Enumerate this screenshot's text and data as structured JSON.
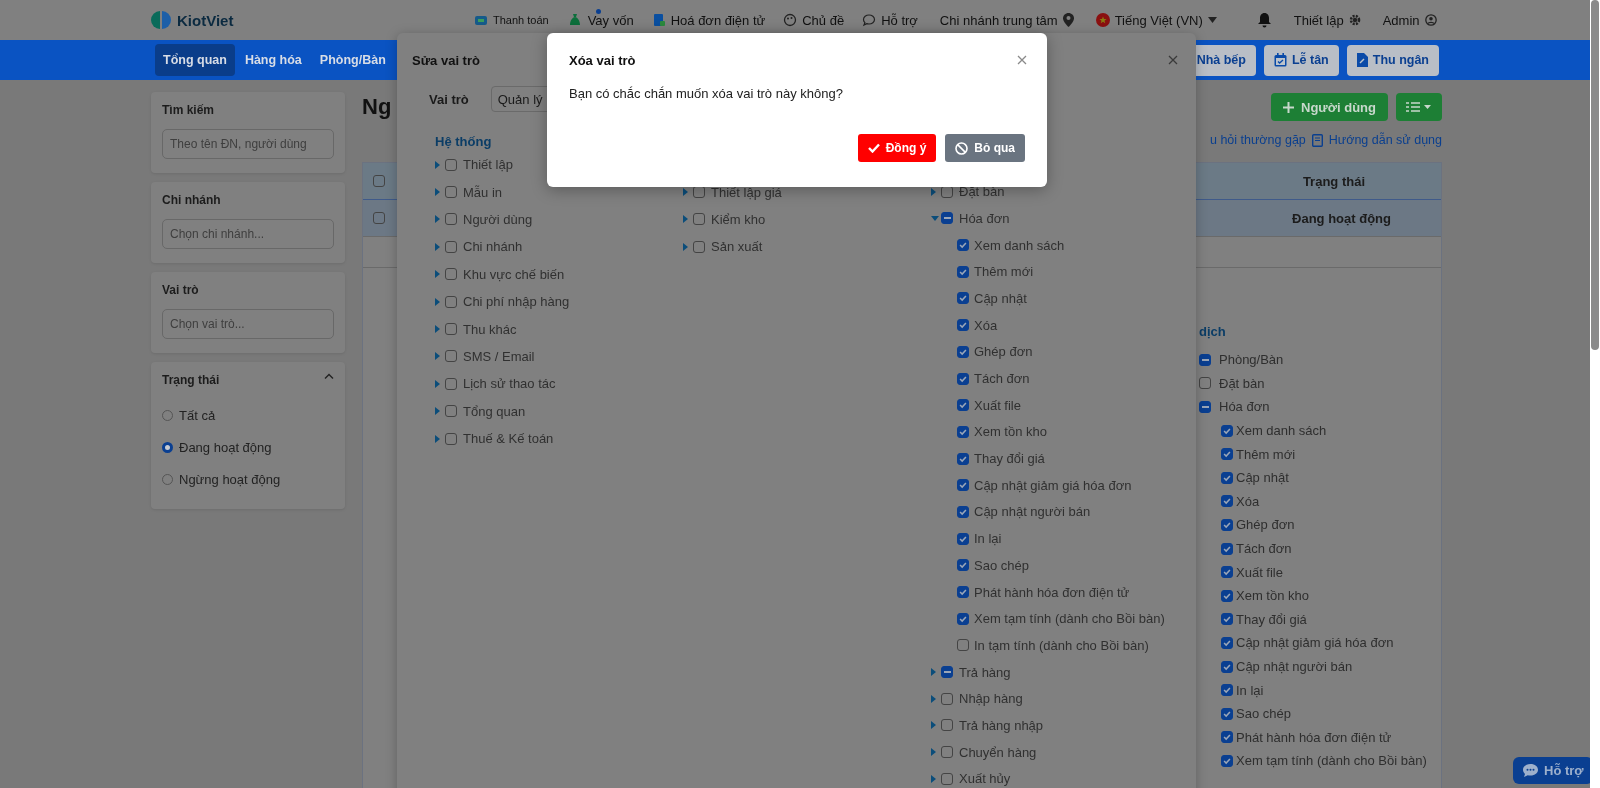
{
  "top_bar": {
    "logo": "KiotViet",
    "links": [
      "Thanh toán",
      "Vay vốn",
      "Hoá đơn điện tử",
      "Chủ đề",
      "Hỗ trợ"
    ],
    "branch": "Chi nhánh trung tâm",
    "language": "Tiếng Việt (VN)",
    "settings": "Thiết lập",
    "user": "Admin"
  },
  "nav": {
    "tabs": [
      {
        "label": "Tổng quan",
        "selected": true
      },
      {
        "label": "Hàng hóa",
        "selected": false
      },
      {
        "label": "Phòng/Bàn",
        "selected": false
      }
    ],
    "actions": [
      "Nhà bếp",
      "Lễ tân",
      "Thu ngân"
    ]
  },
  "sidebar": {
    "filters": [
      {
        "title": "Tìm kiếm",
        "placeholder": "Theo tên ĐN, người dùng"
      },
      {
        "title": "Chi nhánh",
        "placeholder": "Chọn chi nhánh..."
      },
      {
        "title": "Vai trò",
        "placeholder": "Chọn vai trò..."
      }
    ],
    "status": {
      "title": "Trạng thái",
      "expanded": true,
      "options": [
        {
          "label": "Tất cả",
          "selected": false
        },
        {
          "label": "Đang hoạt động",
          "selected": true
        },
        {
          "label": "Ngừng hoạt động",
          "selected": false
        }
      ]
    }
  },
  "main": {
    "heading": "Ng",
    "add_button": "Người dùng",
    "links": [
      "u hỏi thường gặp",
      "Hướng dẫn sử dụng"
    ],
    "table": {
      "header_checked": false,
      "columns": [
        "Trạng thái"
      ],
      "rows": [
        {
          "checked": false,
          "selected": true,
          "status": "Đang hoạt động"
        }
      ]
    },
    "detail": {
      "heading": "dịch",
      "items": [
        {
          "label": "Phòng/Bàn",
          "checked": false,
          "indeterminate": true
        },
        {
          "label": "Đặt bàn",
          "checked": false,
          "indeterminate": false
        },
        {
          "label": "Hóa đơn",
          "checked": false,
          "indeterminate": true,
          "children": [
            {
              "label": "Xem danh sách",
              "checked": true
            },
            {
              "label": "Thêm mới",
              "checked": true
            },
            {
              "label": "Cập nhật",
              "checked": true
            },
            {
              "label": "Xóa",
              "checked": true
            },
            {
              "label": "Ghép đơn",
              "checked": true
            },
            {
              "label": "Tách đơn",
              "checked": true
            },
            {
              "label": "Xuất file",
              "checked": true
            },
            {
              "label": "Xem tồn kho",
              "checked": true
            },
            {
              "label": "Thay đổi giá",
              "checked": true
            },
            {
              "label": "Cập nhật giảm giá hóa đơn",
              "checked": true
            },
            {
              "label": "Cập nhật người bán",
              "checked": true
            },
            {
              "label": "In lại",
              "checked": true
            },
            {
              "label": "Sao chép",
              "checked": true
            },
            {
              "label": "Phát hành hóa đơn điện tử",
              "checked": true
            },
            {
              "label": "Xem tạm tính (dành cho Bồi bàn)",
              "checked": true
            }
          ]
        }
      ]
    }
  },
  "edit_dialog": {
    "title": "Sửa vai trò",
    "role_label": "Vai trò",
    "role_value": "Quản lý",
    "columns": [
      {
        "heading": "Hệ thống",
        "items": [
          {
            "label": "Thiết lập",
            "checked": false,
            "indeterminate": false,
            "expanded": false
          },
          {
            "label": "Mẫu in",
            "checked": false,
            "indeterminate": false,
            "expanded": false
          },
          {
            "label": "Người dùng",
            "checked": false,
            "indeterminate": false,
            "expanded": false
          },
          {
            "label": "Chi nhánh",
            "checked": false,
            "indeterminate": false,
            "expanded": false
          },
          {
            "label": "Khu vực chế biến",
            "checked": false,
            "indeterminate": false,
            "expanded": false
          },
          {
            "label": "Chi phí nhập hàng",
            "checked": false,
            "indeterminate": false,
            "expanded": false
          },
          {
            "label": "Thu khác",
            "checked": false,
            "indeterminate": false,
            "expanded": false
          },
          {
            "label": "SMS / Email",
            "checked": false,
            "indeterminate": false,
            "expanded": false
          },
          {
            "label": "Lịch sử thao tác",
            "checked": false,
            "indeterminate": false,
            "expanded": false
          },
          {
            "label": "Tổng quan",
            "checked": false,
            "indeterminate": false,
            "expanded": false
          },
          {
            "label": "Thuế & Kế toán",
            "checked": false,
            "indeterminate": false,
            "expanded": false
          }
        ]
      },
      {
        "items": [
          {
            "label": "Thiết lập giá",
            "checked": false,
            "indeterminate": false,
            "expanded": false
          },
          {
            "label": "Kiểm kho",
            "checked": false,
            "indeterminate": false,
            "expanded": false
          },
          {
            "label": "Sản xuất",
            "checked": false,
            "indeterminate": false,
            "expanded": false
          }
        ]
      },
      {
        "items": [
          {
            "label": "Đặt bàn",
            "checked": false,
            "indeterminate": false,
            "expanded": false
          },
          {
            "label": "Hóa đơn",
            "checked": false,
            "indeterminate": true,
            "expanded": true,
            "children": [
              {
                "label": "Xem danh sách",
                "checked": true
              },
              {
                "label": "Thêm mới",
                "checked": true
              },
              {
                "label": "Cập nhật",
                "checked": true
              },
              {
                "label": "Xóa",
                "checked": true
              },
              {
                "label": "Ghép đơn",
                "checked": true
              },
              {
                "label": "Tách đơn",
                "checked": true
              },
              {
                "label": "Xuất file",
                "checked": true
              },
              {
                "label": "Xem tồn kho",
                "checked": true
              },
              {
                "label": "Thay đổi giá",
                "checked": true
              },
              {
                "label": "Cập nhật giảm giá hóa đơn",
                "checked": true
              },
              {
                "label": "Cập nhật người bán",
                "checked": true
              },
              {
                "label": "In lại",
                "checked": true
              },
              {
                "label": "Sao chép",
                "checked": true
              },
              {
                "label": "Phát hành hóa đơn điện tử",
                "checked": true
              },
              {
                "label": "Xem tạm tính (dành cho Bồi bàn)",
                "checked": true
              },
              {
                "label": "In tạm tính (dành cho Bồi bàn)",
                "checked": false
              }
            ]
          },
          {
            "label": "Trả hàng",
            "checked": false,
            "indeterminate": true,
            "expanded": false
          },
          {
            "label": "Nhập hàng",
            "checked": false,
            "indeterminate": false,
            "expanded": false
          },
          {
            "label": "Trả hàng nhập",
            "checked": false,
            "indeterminate": false,
            "expanded": false
          },
          {
            "label": "Chuyển hàng",
            "checked": false,
            "indeterminate": false,
            "expanded": false
          },
          {
            "label": "Xuất hủy",
            "checked": false,
            "indeterminate": false,
            "expanded": false
          }
        ]
      }
    ]
  },
  "confirm_dialog": {
    "title": "Xóa vai trò",
    "message": "Bạn có chắc chắn muốn xóa vai trò này không?",
    "buttons": [
      {
        "label": "Đồng ý",
        "kind": "confirm"
      },
      {
        "label": "Bỏ qua",
        "kind": "cancel"
      }
    ]
  },
  "help_button": "Hỗ trợ"
}
